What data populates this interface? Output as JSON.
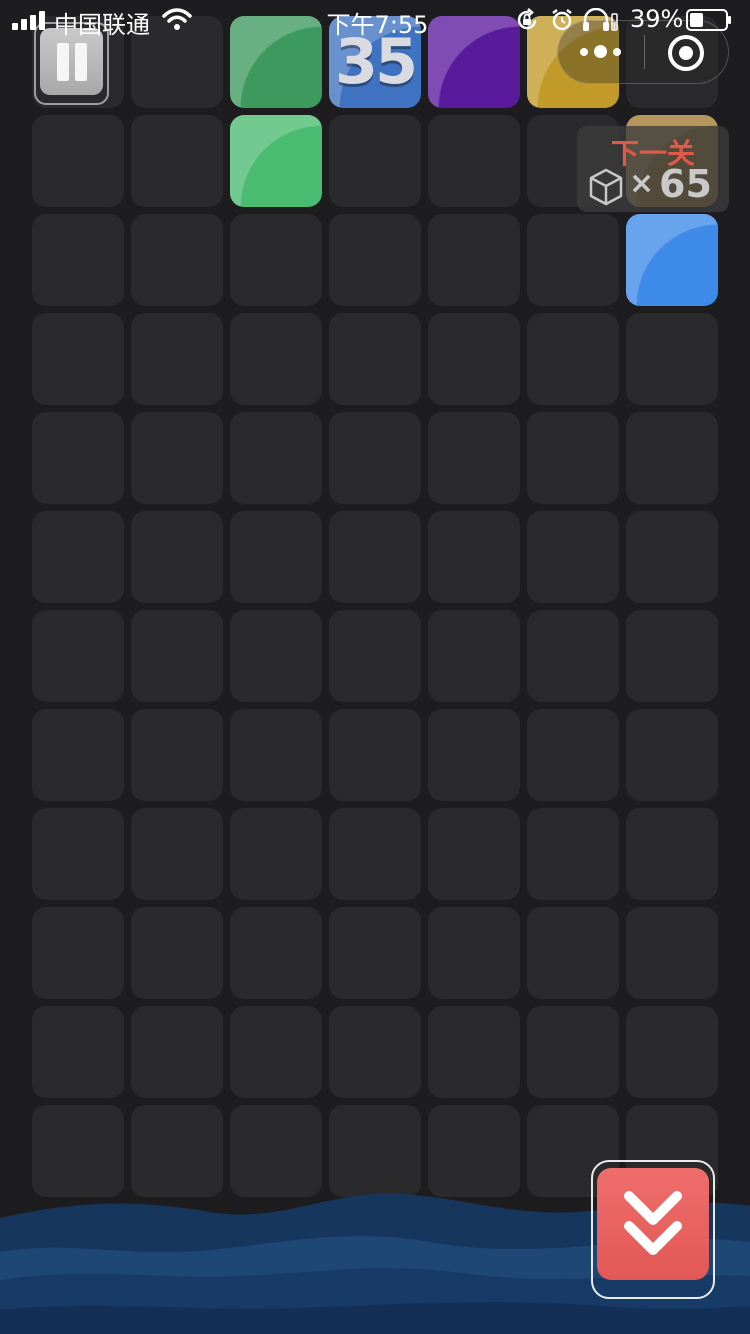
{
  "status_bar": {
    "carrier": "中国联通",
    "time": "下午7:55",
    "battery_percent": "39%",
    "battery_level": 0.39,
    "icons": [
      "signal-icon",
      "wifi-icon",
      "rotation-lock-icon",
      "alarm-icon",
      "headphones-icon",
      "battery-icon"
    ]
  },
  "toolbar": {
    "pause_icon": "pause-icon",
    "menu_icons": [
      "more-icon",
      "close-target-icon"
    ]
  },
  "next_level": {
    "title": "下一关",
    "icon": "cube-icon",
    "times": "×",
    "count": "65"
  },
  "board": {
    "columns": 7,
    "rows": 12,
    "empty_cell_color": "#2a2a2c",
    "tiles": [
      {
        "row": 0,
        "col": 2,
        "color": "#3d9a5f",
        "label": ""
      },
      {
        "row": 0,
        "col": 3,
        "color": "#3f72c0",
        "label": "35"
      },
      {
        "row": 0,
        "col": 4,
        "color": "#5a1a9c",
        "label": ""
      },
      {
        "row": 0,
        "col": 5,
        "color": "#c19a2a",
        "label": ""
      },
      {
        "row": 1,
        "col": 2,
        "color": "#4cbb72",
        "label": ""
      },
      {
        "row": 1,
        "col": 6,
        "color": "#a07a30",
        "label": ""
      },
      {
        "row": 2,
        "col": 6,
        "color": "#3d8ae8",
        "label": ""
      }
    ]
  },
  "controls": {
    "drop_icon": "double-chevron-down-icon",
    "drop_color": "#e8605d"
  },
  "colors": {
    "background": "#1d1d20",
    "wave_dark": "#17355c",
    "wave_light": "#1f4a7c"
  }
}
